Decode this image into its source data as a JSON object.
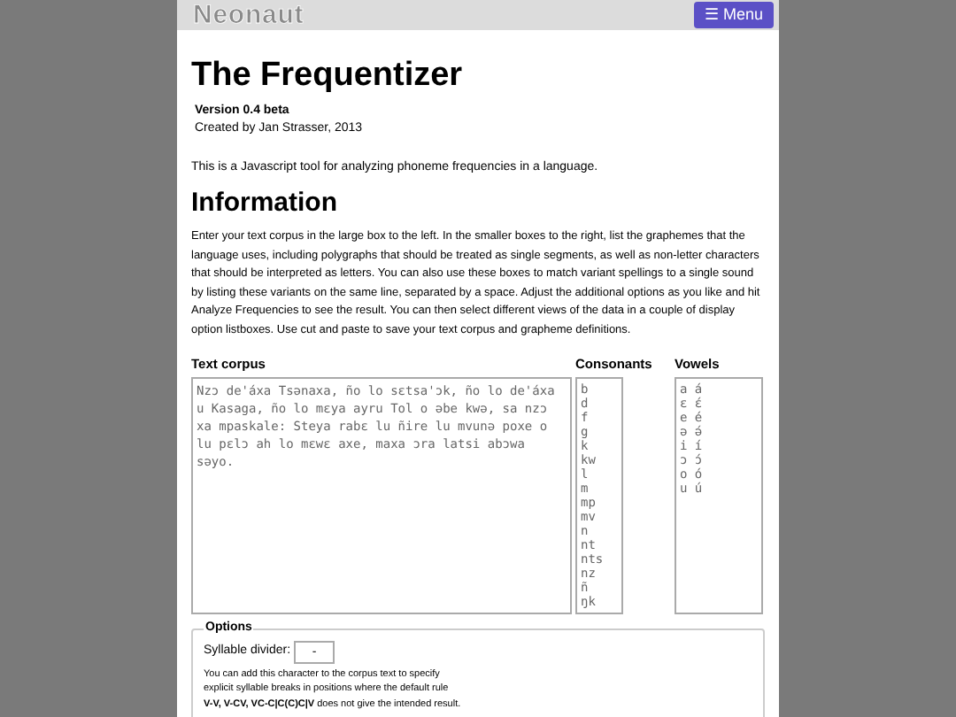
{
  "header": {
    "logo": "Neonaut",
    "menu_button": "☰ Menu"
  },
  "title": "The Frequentizer",
  "version": "Version 0.4 beta",
  "credit": "Created by Jan Strasser, 2013",
  "intro": "This is a Javascript tool for analyzing phoneme frequencies in a language.",
  "information": {
    "heading": "Information",
    "text": "Enter your text corpus in the large box to the left. In the smaller boxes to the right, list the graphemes that the language uses, including polygraphs that should be treated as single segments, as well as non-letter characters that should be interpreted as letters. You can also use these boxes to match variant spellings to a single sound by listing these variants on the same line, separated by a space. Adjust the additional options as you like and hit Analyze Frequencies to see the result. You can then select different views of the data in a couple of display option listboxes. Use cut and paste to save your text corpus and grapheme definitions."
  },
  "corpus": {
    "label": "Text corpus",
    "value": "Nzɔ de'áxa Tsənaxa, ño lo sɛtsa'ɔk, ño lo de'áxa u Kasaga, ño lo mɛya ayru Tol o əbe kwə, sa nzɔ xa mpaskale: Steya rabɛ lu ñire lu mvunə poxe o lu pɛlɔ ah lo mɛwɛ axe, maxa ɔra latsi abɔwa səyo."
  },
  "consonants": {
    "label": "Consonants",
    "value": "b\nd\nf\ng\nk\nkw\nl\nm\nmp\nmv\nn\nnt\nnts\nnz\nñ\nŋk"
  },
  "vowels": {
    "label": "Vowels",
    "value": "a á\nɛ ɛ́\ne é\nə ə́\ni í\nɔ ɔ́\no ó\nu ú"
  },
  "options": {
    "legend": "Options",
    "syllable_divider_label": "Syllable divider:",
    "syllable_divider_value": "-",
    "help_lines": [
      "You can add this character to the corpus text to specify",
      "explicit syllable breaks in positions where the default rule",
      "**V-V, V-CV, VC-C|C(C)C|V** does not give the intended result."
    ]
  }
}
